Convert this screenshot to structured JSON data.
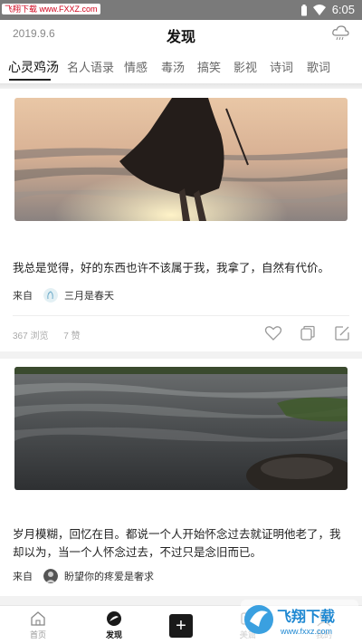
{
  "status_bar": {
    "watermark": "飞翔下载 www.FXXZ.com",
    "time": "6:05"
  },
  "header": {
    "date": "2019.9.6",
    "title": "发现"
  },
  "tabs": [
    {
      "label": "心灵鸡汤",
      "active": true
    },
    {
      "label": "名人语录"
    },
    {
      "label": "情感"
    },
    {
      "label": "毒汤"
    },
    {
      "label": "搞笑"
    },
    {
      "label": "影视"
    },
    {
      "label": "诗词"
    },
    {
      "label": "歌词"
    }
  ],
  "cards": [
    {
      "quote": "我总是觉得，好的东西也许不该属于我，我拿了，自然有代价。",
      "from_label": "来自",
      "author": "三月是春天",
      "views": "367 浏览",
      "likes": "7 赞"
    },
    {
      "quote": "岁月模糊，回忆在目。都说一个人开始怀念过去就证明他老了，我却以为，当一个人怀念过去，不过只是念旧而已。",
      "from_label": "来自",
      "author": "盼望你的疼爱是奢求"
    }
  ],
  "bottom_nav": {
    "home": "首页",
    "discover": "发现",
    "add": "+",
    "beauty": "美篇",
    "mine": "我的"
  },
  "watermark_logo": {
    "brand": "飞翔下载",
    "url": "www.fxxz.com"
  },
  "colors": {
    "accent": "#111111",
    "muted": "#999999",
    "status_bar": "#7a7a7a"
  }
}
